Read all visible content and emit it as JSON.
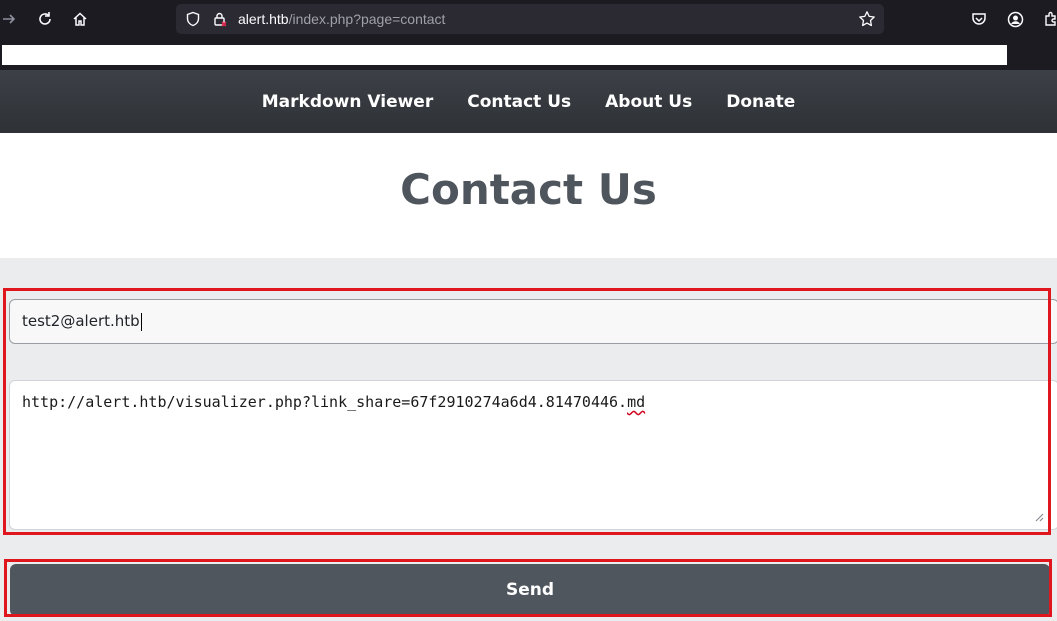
{
  "browser": {
    "url_domain": "alert.htb",
    "url_path": "/index.php?page=contact",
    "icons": [
      "forward-icon",
      "reload-icon",
      "home-icon",
      "shield-icon",
      "lock-icon",
      "star-icon",
      "pocket-icon",
      "account-icon",
      "extensions-icon"
    ]
  },
  "nav": {
    "items": [
      {
        "label": "Markdown Viewer"
      },
      {
        "label": "Contact Us"
      },
      {
        "label": "About Us"
      },
      {
        "label": "Donate"
      }
    ]
  },
  "page": {
    "title": "Contact Us"
  },
  "form": {
    "email_value": "test2@alert.htb",
    "message_value_main": "http://alert.htb/visualizer.php?link_share=67f2910274a6d4.81470446.",
    "message_value_ext": "md",
    "send_label": "Send"
  },
  "colors": {
    "nav_bg": "#34383d",
    "title": "#4f555d",
    "button_bg": "#50565e",
    "highlight": "#e0161f"
  }
}
